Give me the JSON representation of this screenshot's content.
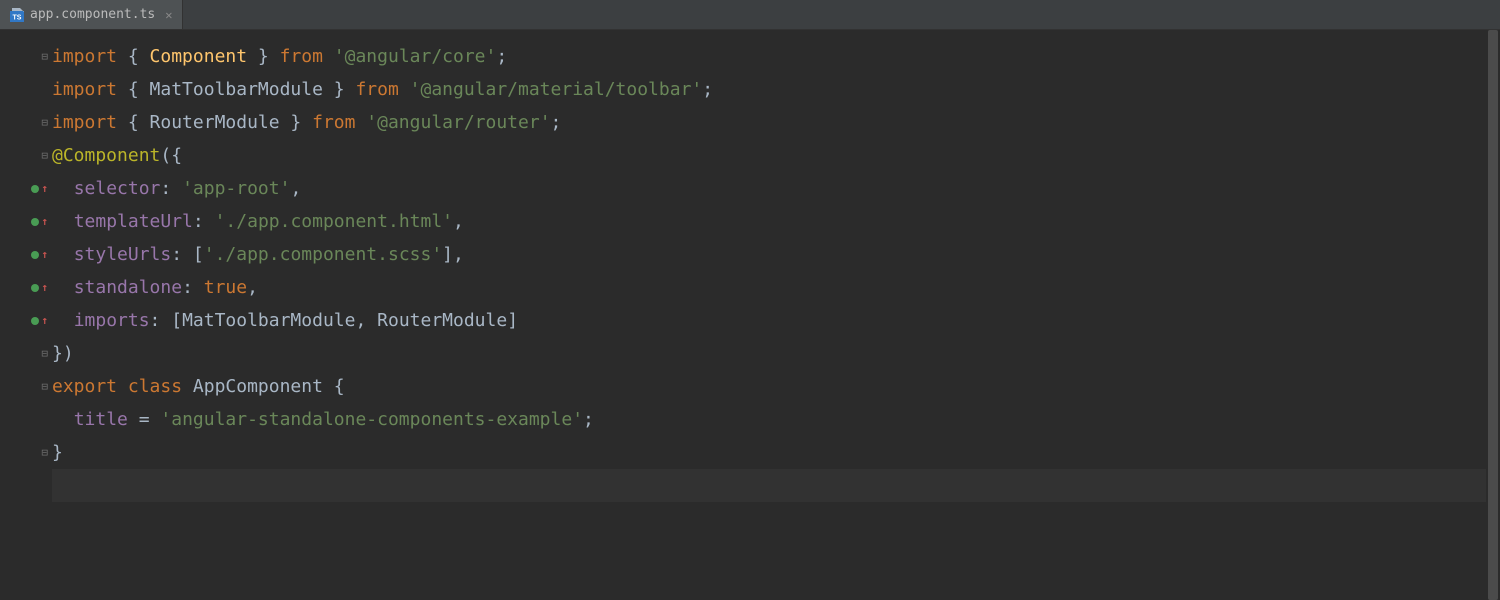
{
  "tab": {
    "filename": "app.component.ts",
    "icon_letters": "TS"
  },
  "gutter": [
    {
      "fold": "⊟"
    },
    {},
    {
      "fold": "⊟"
    },
    {
      "fold": "⊟"
    },
    {
      "marker": true,
      "arrow": "↑"
    },
    {
      "marker": true,
      "arrow": "↑"
    },
    {
      "marker": true,
      "arrow": "↑"
    },
    {
      "marker": true,
      "arrow": "↑"
    },
    {
      "marker": true,
      "arrow": "↑"
    },
    {
      "fold": "⊟"
    },
    {
      "fold": "⊟"
    },
    {},
    {
      "fold": "⊟"
    },
    {}
  ],
  "code": {
    "lines": [
      [
        {
          "t": "import ",
          "c": "kw"
        },
        {
          "t": "{ ",
          "c": "punc"
        },
        {
          "t": "Component",
          "c": "cls"
        },
        {
          "t": " } ",
          "c": "punc"
        },
        {
          "t": "from ",
          "c": "kw"
        },
        {
          "t": "'@angular/core'",
          "c": "str"
        },
        {
          "t": ";",
          "c": "punc"
        }
      ],
      [
        {
          "t": "import ",
          "c": "kw"
        },
        {
          "t": "{ ",
          "c": "punc"
        },
        {
          "t": "MatToolbarModule",
          "c": "plain"
        },
        {
          "t": " } ",
          "c": "punc"
        },
        {
          "t": "from ",
          "c": "kw"
        },
        {
          "t": "'@angular/material/toolbar'",
          "c": "str"
        },
        {
          "t": ";",
          "c": "punc"
        }
      ],
      [
        {
          "t": "import ",
          "c": "kw"
        },
        {
          "t": "{ ",
          "c": "punc"
        },
        {
          "t": "RouterModule",
          "c": "plain"
        },
        {
          "t": " } ",
          "c": "punc"
        },
        {
          "t": "from ",
          "c": "kw"
        },
        {
          "t": "'@angular/router'",
          "c": "str"
        },
        {
          "t": ";",
          "c": "punc"
        }
      ],
      [
        {
          "t": "@Component",
          "c": "decor"
        },
        {
          "t": "({",
          "c": "punc"
        }
      ],
      [
        {
          "t": "  ",
          "c": "plain"
        },
        {
          "t": "selector",
          "c": "id"
        },
        {
          "t": ": ",
          "c": "punc"
        },
        {
          "t": "'app-root'",
          "c": "str"
        },
        {
          "t": ",",
          "c": "punc"
        }
      ],
      [
        {
          "t": "  ",
          "c": "plain"
        },
        {
          "t": "templateUrl",
          "c": "id"
        },
        {
          "t": ": ",
          "c": "punc"
        },
        {
          "t": "'./app.component.html'",
          "c": "str"
        },
        {
          "t": ",",
          "c": "punc"
        }
      ],
      [
        {
          "t": "  ",
          "c": "plain"
        },
        {
          "t": "styleUrls",
          "c": "id"
        },
        {
          "t": ": [",
          "c": "punc"
        },
        {
          "t": "'./app.component.scss'",
          "c": "str"
        },
        {
          "t": "],",
          "c": "punc"
        }
      ],
      [
        {
          "t": "  ",
          "c": "plain"
        },
        {
          "t": "standalone",
          "c": "id"
        },
        {
          "t": ": ",
          "c": "punc"
        },
        {
          "t": "true",
          "c": "kw"
        },
        {
          "t": ",",
          "c": "punc"
        }
      ],
      [
        {
          "t": "  ",
          "c": "plain"
        },
        {
          "t": "imports",
          "c": "id"
        },
        {
          "t": ": [",
          "c": "punc"
        },
        {
          "t": "MatToolbarModule",
          "c": "plain"
        },
        {
          "t": ", ",
          "c": "punc"
        },
        {
          "t": "RouterModule",
          "c": "plain"
        },
        {
          "t": "]",
          "c": "punc"
        }
      ],
      [
        {
          "t": "})",
          "c": "punc"
        }
      ],
      [
        {
          "t": "export class ",
          "c": "kw"
        },
        {
          "t": "AppComponent",
          "c": "plain"
        },
        {
          "t": " {",
          "c": "punc"
        }
      ],
      [
        {
          "t": "  ",
          "c": "plain"
        },
        {
          "t": "title",
          "c": "id"
        },
        {
          "t": " = ",
          "c": "punc"
        },
        {
          "t": "'angular-standalone-components-example'",
          "c": "str"
        },
        {
          "t": ";",
          "c": "punc"
        }
      ],
      [
        {
          "t": "}",
          "c": "punc"
        }
      ],
      [
        {
          "t": "",
          "c": "plain"
        }
      ]
    ],
    "current_line_index": 13
  },
  "scrollbar": {
    "thumb_top": 0,
    "thumb_height": 570
  }
}
